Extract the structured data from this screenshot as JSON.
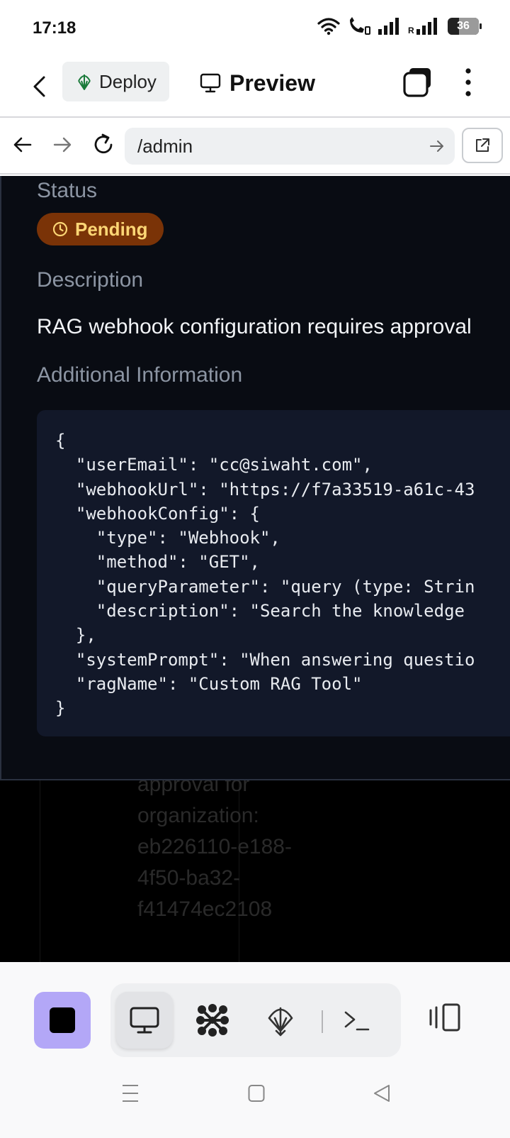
{
  "status_bar": {
    "time": "17:18",
    "battery": "36",
    "battery_level": 0.36
  },
  "header": {
    "deploy_label": "Deploy",
    "preview_label": "Preview"
  },
  "url_bar": {
    "url": "/admin"
  },
  "content": {
    "status_label": "Status",
    "status_badge": "Pending",
    "description_label": "Description",
    "description_text": "RAG webhook configuration requires approval",
    "additional_label": "Additional Information",
    "code_lines": [
      "{",
      "  \"userEmail\": \"cc@siwaht.com\",",
      "  \"webhookUrl\": \"https://f7a33519-a61c-43",
      "  \"webhookConfig\": {",
      "    \"type\": \"Webhook\",",
      "    \"method\": \"GET\",",
      "    \"queryParameter\": \"query (type: Strin",
      "    \"description\": \"Search the knowledge ",
      "  },",
      "  \"systemPrompt\": \"When answering questio",
      "  \"ragName\": \"Custom RAG Tool\"",
      "}"
    ],
    "background_text": [
      "approval for",
      "organization:",
      "eb226110-e188-",
      "4f50-ba32-",
      "f41474ec2108"
    ]
  },
  "colors": {
    "accent": "#b3a7f7",
    "badge_bg": "#7a3307",
    "badge_text": "#fcd675",
    "panel_bg": "#090c13",
    "code_bg": "#121829"
  }
}
